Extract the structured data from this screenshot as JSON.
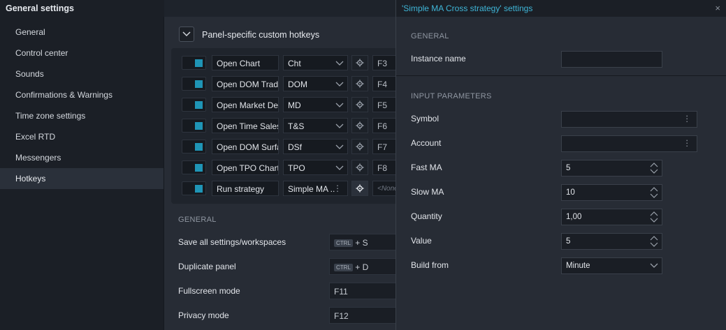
{
  "window": {
    "title": "General settings"
  },
  "sidebar": {
    "items": [
      {
        "label": "General"
      },
      {
        "label": "Control center"
      },
      {
        "label": "Sounds"
      },
      {
        "label": "Confirmations & Warnings"
      },
      {
        "label": "Time zone settings"
      },
      {
        "label": "Excel RTD"
      },
      {
        "label": "Messengers"
      },
      {
        "label": "Hotkeys"
      }
    ],
    "active": "Hotkeys"
  },
  "hotkeys": {
    "section_title": "Panel-specific custom hotkeys",
    "rows": [
      {
        "name": "Open Chart",
        "combo": "Cht",
        "key": "F3"
      },
      {
        "name": "Open DOM Trad",
        "combo": "DOM",
        "key": "F4"
      },
      {
        "name": "Open Market De",
        "combo": "MD",
        "key": "F5"
      },
      {
        "name": "Open Time Sales",
        "combo": "T&S",
        "key": "F6"
      },
      {
        "name": "Open DOM Surfa",
        "combo": "DSf",
        "key": "F7"
      },
      {
        "name": "Open TPO Chart",
        "combo": "TPO",
        "key": "F8"
      },
      {
        "name": "Run strategy",
        "combo": "Simple MA ..",
        "key": "<None>"
      }
    ]
  },
  "general": {
    "label": "GENERAL",
    "rows": [
      {
        "label": "Save all settings/workspaces",
        "kbd": "CTRL",
        "key": "+ S"
      },
      {
        "label": "Duplicate panel",
        "kbd": "CTRL",
        "key": "+ D"
      },
      {
        "label": "Fullscreen mode",
        "kbd": "",
        "key": "F11"
      },
      {
        "label": "Privacy mode",
        "kbd": "",
        "key": "F12"
      }
    ]
  },
  "dialog": {
    "title": "'Simple MA Cross strategy' settings",
    "close": "×",
    "general_label": "GENERAL",
    "instance_name_label": "Instance name",
    "instance_name_value": "",
    "input_params_label": "INPUT PARAMETERS",
    "symbol_label": "Symbol",
    "symbol_value": "",
    "account_label": "Account",
    "account_value": "",
    "fast_ma_label": "Fast MA",
    "fast_ma_value": "5",
    "slow_ma_label": "Slow MA",
    "slow_ma_value": "10",
    "quantity_label": "Quantity",
    "quantity_value": "1,00",
    "value_label": "Value",
    "value_value": "5",
    "build_from_label": "Build from",
    "build_from_value": "Minute"
  },
  "colors": {
    "accent": "#1f95b6",
    "dialog_title": "#3fb6d8"
  }
}
